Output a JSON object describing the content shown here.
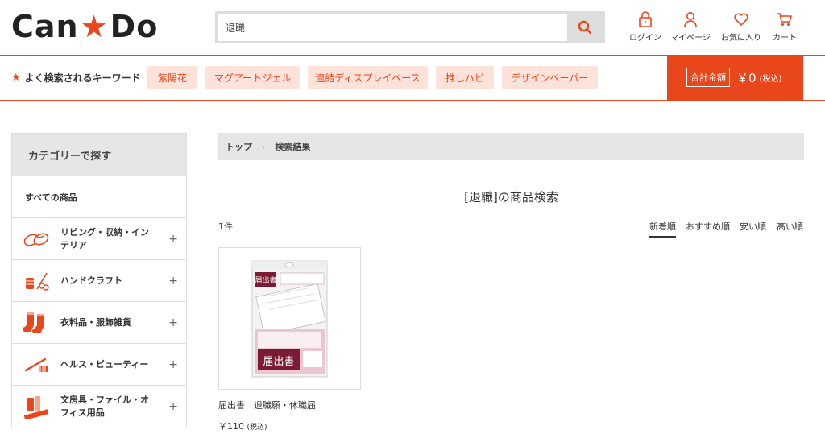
{
  "header": {
    "logo_left": "Can",
    "logo_star": "★",
    "logo_right": "Do",
    "search_value": "退職",
    "nav": [
      {
        "label": "ログイン",
        "icon": "lock-icon"
      },
      {
        "label": "マイページ",
        "icon": "person-icon"
      },
      {
        "label": "お気に入り",
        "icon": "heart-icon"
      },
      {
        "label": "カート",
        "icon": "cart-icon"
      }
    ]
  },
  "keywords": {
    "label": "よく検索されるキーワード",
    "items": [
      "紫陽花",
      "マグアートジェル",
      "連結ディスプレイベース",
      "推しハピ",
      "デザインペーパー"
    ]
  },
  "total": {
    "label": "合計金額",
    "amount": "￥0",
    "tax": "(税込)"
  },
  "sidebar": {
    "heading": "カテゴリーで探す",
    "all_label": "すべての商品",
    "items": [
      {
        "label": "リビング・収納・インテリア",
        "icon": "slippers-icon"
      },
      {
        "label": "ハンドクラフト",
        "icon": "sewing-icon"
      },
      {
        "label": "衣料品・服飾雑貨",
        "icon": "socks-icon"
      },
      {
        "label": "ヘルス・ビューティー",
        "icon": "toothbrush-icon"
      },
      {
        "label": "文房具・ファイル・オフィス用品",
        "icon": "stationery-icon"
      }
    ]
  },
  "breadcrumb": [
    "トップ",
    "検索結果"
  ],
  "results": {
    "title": "[退職]の商品検索",
    "count": "1件",
    "sort": [
      "新着順",
      "おすすめ順",
      "安い順",
      "高い順"
    ]
  },
  "product": {
    "name": "届出書　退職願・休職届",
    "price": "￥110",
    "price_tax": "(税込)",
    "package_title": "届出書"
  },
  "colors": {
    "accent": "#e8471c",
    "keyword_bg": "#fde2da",
    "panel_gray": "#e6e6e6"
  }
}
